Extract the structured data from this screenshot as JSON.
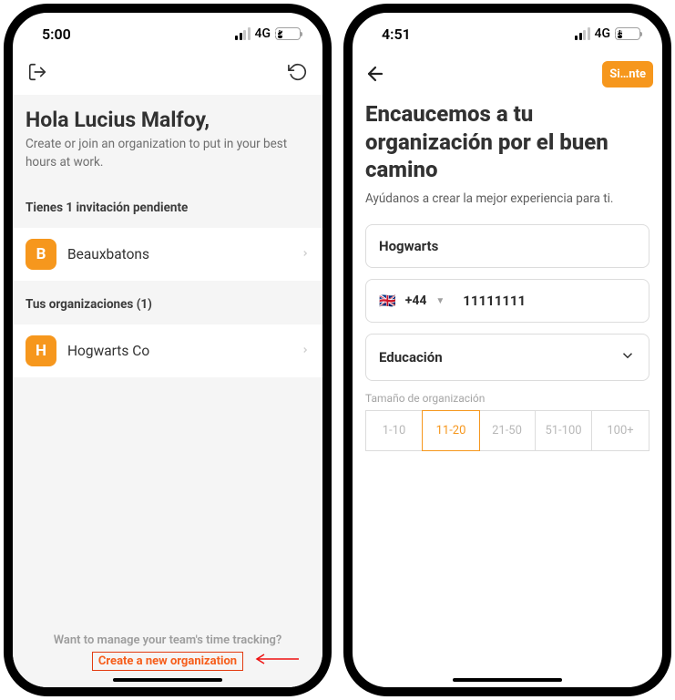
{
  "screen1": {
    "status": {
      "time": "5:00",
      "network": "4G",
      "battery": "22",
      "battery_pct": 22
    },
    "greeting_title": "Hola Lucius Malfoy,",
    "greeting_sub": "Create or join an organization to put in your best hours at work.",
    "pending_label": "Tienes 1 invitación pendiente",
    "invite": {
      "initial": "B",
      "name": "Beauxbatons"
    },
    "orgs_label": "Tus organizaciones (1)",
    "org": {
      "initial": "H",
      "name": "Hogwarts Co"
    },
    "footer_q": "Want to manage your team's time tracking?",
    "create_link": "Create a new organization"
  },
  "screen2": {
    "status": {
      "time": "4:51",
      "network": "4G",
      "battery": "25",
      "battery_pct": 25
    },
    "next_label": "Si…nte",
    "title": "Encaucemos a tu organización por el buen camino",
    "subtitle": "Ayúdanos a crear la mejor experiencia para ti.",
    "org_name": "Hogwarts",
    "phone": {
      "code": "+44",
      "number": "11111111"
    },
    "category": "Educación",
    "size_label": "Tamaño de organización",
    "sizes": [
      "1-10",
      "11-20",
      "21-50",
      "51-100",
      "100+"
    ],
    "size_selected": "11-20"
  }
}
